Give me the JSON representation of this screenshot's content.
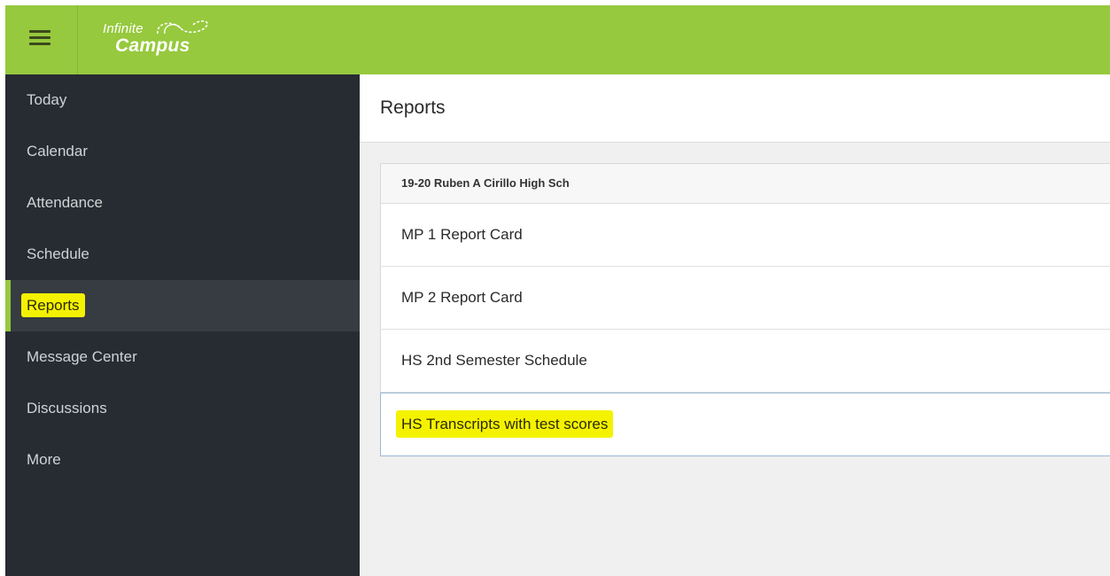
{
  "header": {
    "logo_line1": "Infinite",
    "logo_line2": "Campus",
    "brand_color": "#96c93d"
  },
  "sidebar": {
    "items": [
      {
        "label": "Today"
      },
      {
        "label": "Calendar"
      },
      {
        "label": "Attendance"
      },
      {
        "label": "Schedule"
      },
      {
        "label": "Reports",
        "active": true
      },
      {
        "label": "Message Center"
      },
      {
        "label": "Discussions"
      },
      {
        "label": "More"
      }
    ],
    "background": "#262c31",
    "highlight_color": "#f5f200"
  },
  "main": {
    "title": "Reports",
    "card": {
      "header": "19-20 Ruben A Cirillo High Sch",
      "reports": [
        {
          "label": "MP 1 Report Card"
        },
        {
          "label": "MP 2 Report Card"
        },
        {
          "label": "HS 2nd Semester Schedule"
        },
        {
          "label": "HS Transcripts with test scores",
          "selected": true
        }
      ]
    }
  },
  "icons": {
    "menu": "hamburger-menu-icon",
    "logo": "infinite-campus-logo-icon"
  }
}
